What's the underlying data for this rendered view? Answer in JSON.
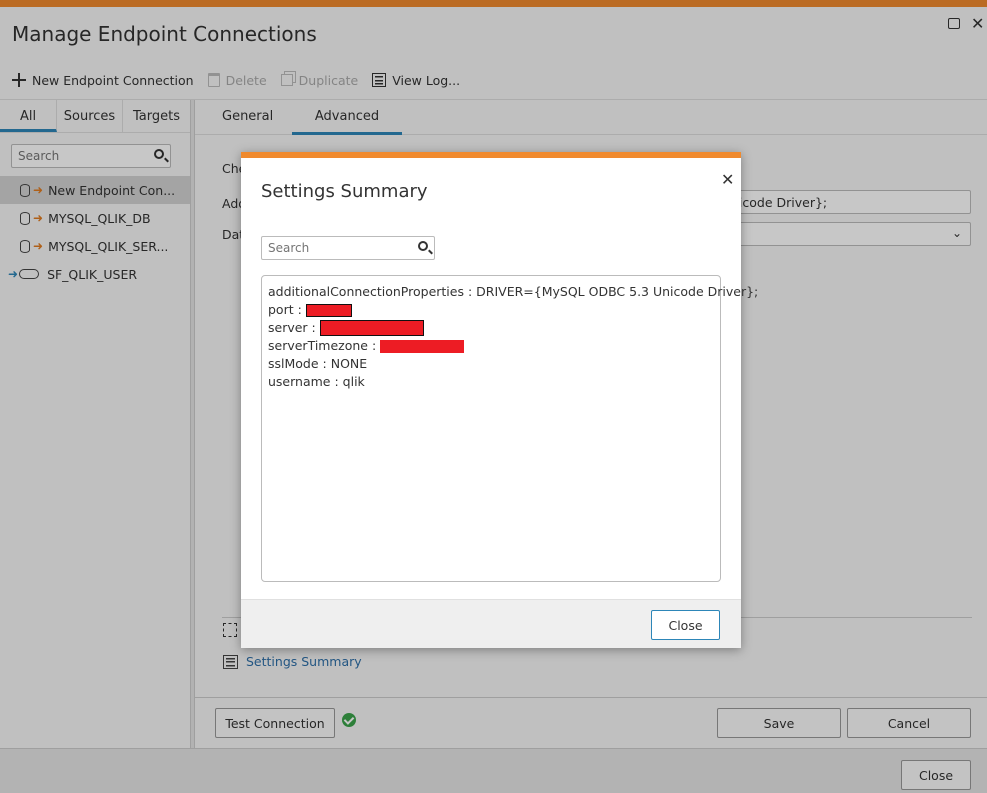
{
  "window": {
    "title": "Manage Endpoint Connections",
    "maximize_icon": "maximize-icon",
    "close_icon": "close-icon"
  },
  "toolbar": {
    "new_label": "New Endpoint Connection",
    "delete_label": "Delete",
    "duplicate_label": "Duplicate",
    "view_log_label": "View Log..."
  },
  "left": {
    "tabs": [
      "All",
      "Sources",
      "Targets"
    ],
    "search_placeholder": "Search",
    "endpoints": [
      {
        "name": "New Endpoint Con...",
        "type": "database",
        "selected": true
      },
      {
        "name": "MYSQL_QLIK_DB",
        "type": "database",
        "selected": false
      },
      {
        "name": "MYSQL_QLIK_SER...",
        "type": "database",
        "selected": false
      },
      {
        "name": "SF_QLIK_USER",
        "type": "cloud",
        "selected": false
      }
    ]
  },
  "right": {
    "tabs": [
      "General",
      "Advanced"
    ],
    "active_tab": "Advanced",
    "background_labels": [
      "Che",
      "Add",
      "Dat"
    ],
    "background_field_value": "nicode Driver};",
    "settings_summary_link": "Settings Summary"
  },
  "footer": {
    "test_connection": "Test Connection",
    "save": "Save",
    "cancel": "Cancel",
    "close": "Close"
  },
  "modal": {
    "title": "Settings Summary",
    "search_placeholder": "Search",
    "summary": [
      {
        "key": "additionalConnectionProperties",
        "value": "DRIVER={MySQL ODBC 5.3 Unicode Driver};",
        "redacted": false
      },
      {
        "key": "port",
        "value": "",
        "redacted": true
      },
      {
        "key": "server",
        "value": "",
        "redacted": true
      },
      {
        "key": "serverTimezone",
        "value": "",
        "redacted": true
      },
      {
        "key": "sslMode",
        "value": "NONE",
        "redacted": false
      },
      {
        "key": "username",
        "value": "qlik",
        "redacted": false
      }
    ],
    "close_label": "Close"
  },
  "colors": {
    "accent_orange": "#f08a2e",
    "accent_blue": "#2d86b8",
    "link_blue": "#2d6fa8",
    "redaction": "#ed1c24",
    "success_green": "#3aa34a"
  }
}
